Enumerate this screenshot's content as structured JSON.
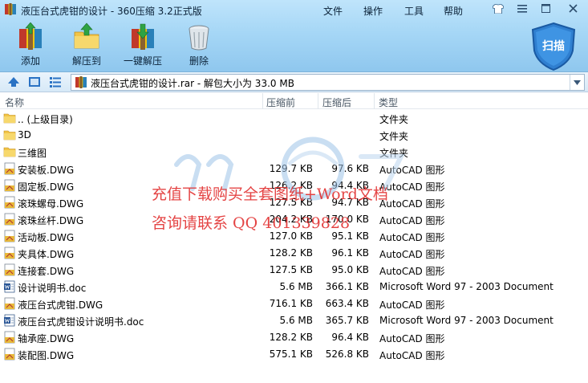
{
  "window": {
    "title": "液压台式虎钳的设计 - 360压缩 3.2正式版",
    "menus": [
      "文件",
      "操作",
      "工具",
      "帮助"
    ]
  },
  "toolbar": {
    "add": "添加",
    "extract": "解压到",
    "one_click": "一键解压",
    "delete": "删除",
    "scan": "扫描"
  },
  "address": {
    "path": "液压台式虎钳的设计.rar - 解包大小为 33.0 MB"
  },
  "columns": {
    "name": "名称",
    "compressed": "压缩前",
    "original": "压缩后",
    "type": "类型"
  },
  "files": [
    {
      "name": ".. (上级目录)",
      "csize": "",
      "osize": "",
      "type": "文件夹",
      "kind": "folder"
    },
    {
      "name": "3D",
      "csize": "",
      "osize": "",
      "type": "文件夹",
      "kind": "folder"
    },
    {
      "name": "三维图",
      "csize": "",
      "osize": "",
      "type": "文件夹",
      "kind": "folder"
    },
    {
      "name": "安装板.DWG",
      "csize": "129.7 KB",
      "osize": "97.6 KB",
      "type": "AutoCAD 图形",
      "kind": "dwg"
    },
    {
      "name": "固定板.DWG",
      "csize": "126.2 KB",
      "osize": "94.4 KB",
      "type": "AutoCAD 图形",
      "kind": "dwg"
    },
    {
      "name": "滚珠螺母.DWG",
      "csize": "127.5 KB",
      "osize": "94.7 KB",
      "type": "AutoCAD 图形",
      "kind": "dwg"
    },
    {
      "name": "滚珠丝杆.DWG",
      "csize": "204.2 KB",
      "osize": "170.0 KB",
      "type": "AutoCAD 图形",
      "kind": "dwg"
    },
    {
      "name": "活动板.DWG",
      "csize": "127.0 KB",
      "osize": "95.1 KB",
      "type": "AutoCAD 图形",
      "kind": "dwg"
    },
    {
      "name": "夹具体.DWG",
      "csize": "128.2 KB",
      "osize": "96.1 KB",
      "type": "AutoCAD 图形",
      "kind": "dwg"
    },
    {
      "name": "连接套.DWG",
      "csize": "127.5 KB",
      "osize": "95.0 KB",
      "type": "AutoCAD 图形",
      "kind": "dwg"
    },
    {
      "name": "设计说明书.doc",
      "csize": "5.6 MB",
      "osize": "366.1 KB",
      "type": "Microsoft Word 97 - 2003 Document",
      "kind": "doc"
    },
    {
      "name": "液压台式虎钳.DWG",
      "csize": "716.1 KB",
      "osize": "663.4 KB",
      "type": "AutoCAD 图形",
      "kind": "dwg"
    },
    {
      "name": "液压台式虎钳设计说明书.doc",
      "csize": "5.6 MB",
      "osize": "365.7 KB",
      "type": "Microsoft Word 97 - 2003 Document",
      "kind": "doc"
    },
    {
      "name": "轴承座.DWG",
      "csize": "128.2 KB",
      "osize": "96.4 KB",
      "type": "AutoCAD 图形",
      "kind": "dwg"
    },
    {
      "name": "装配图.DWG",
      "csize": "575.1 KB",
      "osize": "526.8 KB",
      "type": "AutoCAD 图形",
      "kind": "dwg"
    }
  ],
  "watermark": {
    "line1": "充值下载购买全套图纸+Word文档",
    "line2": "咨询请联系 QQ 401339828"
  },
  "colors": {
    "accent": "#2a72c4",
    "watermark_text": "#e23030"
  }
}
